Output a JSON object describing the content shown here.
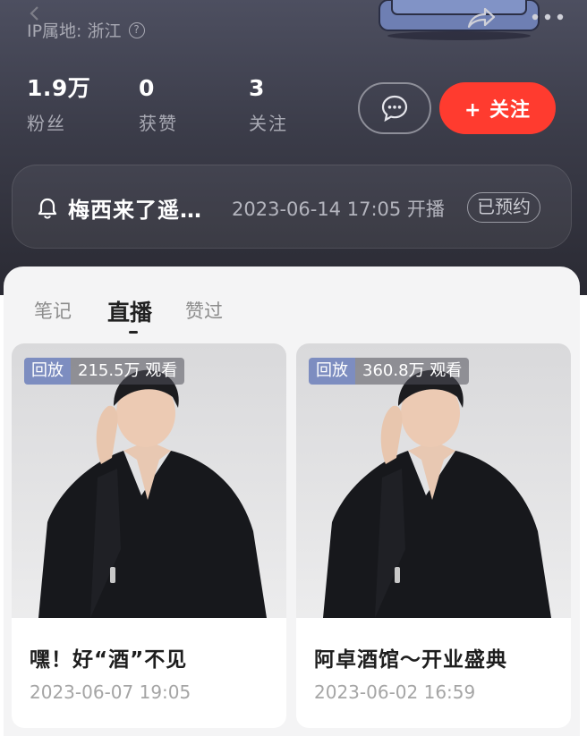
{
  "header": {
    "ip_location": "IP属地: 浙江",
    "help_symbol": "?",
    "icons": [
      "chevron-left-icon",
      "sofa-illustration",
      "share-icon",
      "more-icon"
    ]
  },
  "stats": [
    {
      "num": "1.9万",
      "label": "粉丝"
    },
    {
      "num": "0",
      "label": "获赞"
    },
    {
      "num": "3",
      "label": "关注"
    }
  ],
  "actions": {
    "follow_label": "+ 关注"
  },
  "live_notice": {
    "title": "梅西来了遥…",
    "time": "2023-06-14 17:05 开播",
    "badge": "已预约"
  },
  "tabs": [
    {
      "label": "笔记",
      "active": false
    },
    {
      "label": "直播",
      "active": true
    },
    {
      "label": "赞过",
      "active": false
    }
  ],
  "cards": [
    {
      "tag": "回放",
      "views": "215.5万 观看",
      "title": "嘿！好“酒”不见",
      "date": "2023-06-07 19:05"
    },
    {
      "tag": "回放",
      "views": "360.8万 观看",
      "title": "阿卓酒馆～开业盛典",
      "date": "2023-06-02 16:59"
    }
  ],
  "colors": {
    "follow": "#ff3b2f",
    "header_bg": "#3b3c49",
    "replay_tag": "#7d8dc0"
  }
}
